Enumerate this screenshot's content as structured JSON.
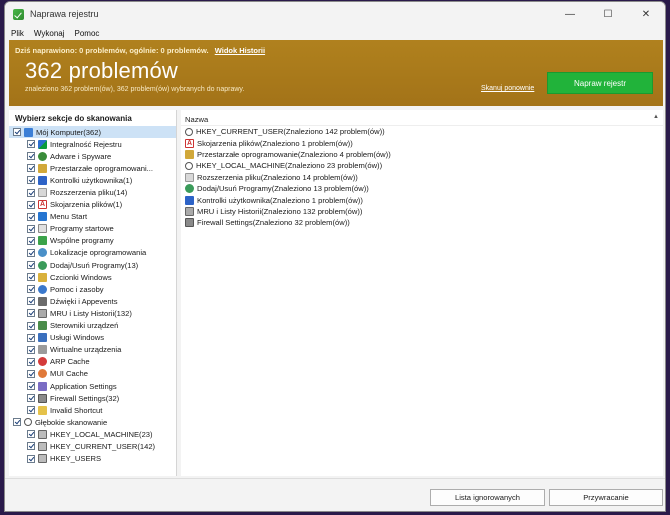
{
  "window": {
    "title": "Naprawa rejestru",
    "controls": [
      "—",
      "☐",
      "✕"
    ]
  },
  "menu": [
    "Plik",
    "Wykonaj",
    "Pomoc"
  ],
  "banner": {
    "today_line": "Dziś naprawiono: 0 problemów, ogólnie: 0 problemów.",
    "history_link": "Widok Historii",
    "count": "362 problemów",
    "sub": "znaleziono 362 problem(ów), 362 problem(ów) wybranych do naprawy.",
    "rescan": "Skanuj ponownie",
    "fix_button": "Napraw rejestr",
    "color": "#aa7a1b",
    "fix_color": "#21b33a"
  },
  "left": {
    "title": "Wybierz sekcje do skanowania",
    "root": {
      "label": "Mój Komputer(362)",
      "icon": "computer-icon"
    },
    "children": [
      {
        "label": "Integralność Rejestru",
        "icon": "ic-reg"
      },
      {
        "label": "Adware i Spyware",
        "icon": "ic-bug"
      },
      {
        "label": "Przestarzałe oprogramowani...",
        "icon": "ic-box"
      },
      {
        "label": "Kontrolki użytkownika(1)",
        "icon": "ic-user"
      },
      {
        "label": "Rozszerzenia pliku(14)",
        "icon": "ic-file"
      },
      {
        "label": "Skojarzenia plików(1)",
        "icon": "ic-a"
      },
      {
        "label": "Menu Start",
        "icon": "ic-win"
      },
      {
        "label": "Programy startowe",
        "icon": "ic-prog"
      },
      {
        "label": "Wspólne programy",
        "icon": "ic-share"
      },
      {
        "label": "Lokalizacje oprogramowania",
        "icon": "ic-globe"
      },
      {
        "label": "Dodaj/Usuń Programy(13)",
        "icon": "ic-cd"
      },
      {
        "label": "Czcionki Windows",
        "icon": "ic-font"
      },
      {
        "label": "Pomoc i zasoby",
        "icon": "ic-help"
      },
      {
        "label": "Dźwięki i Appevents",
        "icon": "ic-sound"
      },
      {
        "label": "MRU i Listy Historii(132)",
        "icon": "ic-mru"
      },
      {
        "label": "Sterowniki urządzeń",
        "icon": "ic-drv"
      },
      {
        "label": "Usługi Windows",
        "icon": "ic-svc"
      },
      {
        "label": "Wirtualne urządzenia",
        "icon": "ic-vdev"
      },
      {
        "label": "ARP Cache",
        "icon": "ic-arp"
      },
      {
        "label": "MUI Cache",
        "icon": "ic-mui"
      },
      {
        "label": "Application Settings",
        "icon": "ic-app"
      },
      {
        "label": "Firewall Settings(32)",
        "icon": "ic-fw"
      },
      {
        "label": "Invalid Shortcut",
        "icon": "ic-short"
      }
    ],
    "root2": {
      "label": "Głębokie skanowanie",
      "icon": "ic-deep"
    },
    "children2": [
      {
        "label": "HKEY_LOCAL_MACHINE(23)",
        "icon": "ic-hk"
      },
      {
        "label": "HKEY_CURRENT_USER(142)",
        "icon": "ic-hk"
      },
      {
        "label": "HKEY_USERS",
        "icon": "ic-hk"
      }
    ]
  },
  "right": {
    "header": "Nazwa",
    "rows": [
      {
        "label": "HKEY_CURRENT_USER(Znaleziono 142 problem(ów))",
        "icon": "ic-search"
      },
      {
        "label": "Skojarzenia plików(Znaleziono 1 problem(ów))",
        "icon": "ic-a"
      },
      {
        "label": "Przestarzałe oprogramowanie(Znaleziono 4 problem(ów))",
        "icon": "ic-box"
      },
      {
        "label": "HKEY_LOCAL_MACHINE(Znaleziono 23 problem(ów))",
        "icon": "ic-search"
      },
      {
        "label": "Rozszerzenia pliku(Znaleziono 14 problem(ów))",
        "icon": "ic-file"
      },
      {
        "label": "Dodaj/Usuń Programy(Znaleziono 13 problem(ów))",
        "icon": "ic-cd"
      },
      {
        "label": "Kontrolki użytkownika(Znaleziono 1 problem(ów))",
        "icon": "ic-user"
      },
      {
        "label": "MRU i Listy Historii(Znaleziono 132 problem(ów))",
        "icon": "ic-mru"
      },
      {
        "label": "Firewall Settings(Znaleziono 32 problem(ów))",
        "icon": "ic-fw"
      }
    ]
  },
  "bottom": {
    "ignored": "Lista ignorowanych",
    "restore": "Przywracanie"
  }
}
